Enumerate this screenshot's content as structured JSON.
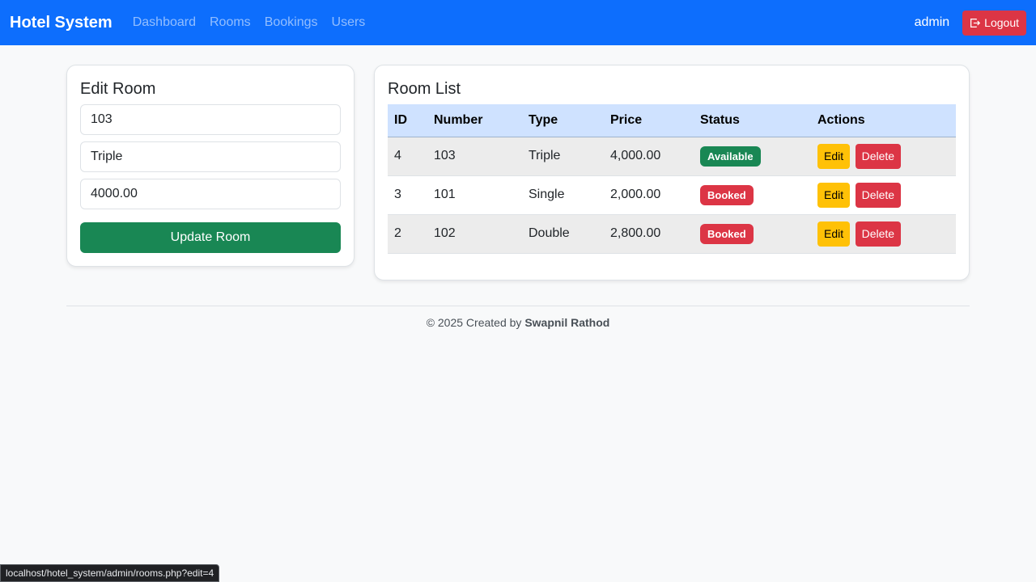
{
  "navbar": {
    "brand": "Hotel System",
    "links": [
      "Dashboard",
      "Rooms",
      "Bookings",
      "Users"
    ],
    "user": "admin",
    "logout_label": "Logout"
  },
  "edit_form": {
    "title": "Edit Room",
    "room_number": "103",
    "room_type": "Triple",
    "price": "4000.00",
    "submit_label": "Update Room"
  },
  "room_list": {
    "title": "Room List",
    "headers": [
      "ID",
      "Number",
      "Type",
      "Price",
      "Status",
      "Actions"
    ],
    "rows": [
      {
        "id": "4",
        "number": "103",
        "type": "Triple",
        "price": "4,000.00",
        "status": "Available",
        "edit": "Edit",
        "delete": "Delete"
      },
      {
        "id": "3",
        "number": "101",
        "type": "Single",
        "price": "2,000.00",
        "status": "Booked",
        "edit": "Edit",
        "delete": "Delete"
      },
      {
        "id": "2",
        "number": "102",
        "type": "Double",
        "price": "2,800.00",
        "status": "Booked",
        "edit": "Edit",
        "delete": "Delete"
      }
    ]
  },
  "footer": {
    "prefix": "© 2025 Created by",
    "author": "Swapnil Rathod"
  },
  "status_bar_url": "localhost/hotel_system/admin/rooms.php?edit=4",
  "colors": {
    "primary": "#0d6efd",
    "success": "#198754",
    "danger": "#dc3545",
    "warning": "#ffc107",
    "table_header": "#cfe2ff"
  }
}
